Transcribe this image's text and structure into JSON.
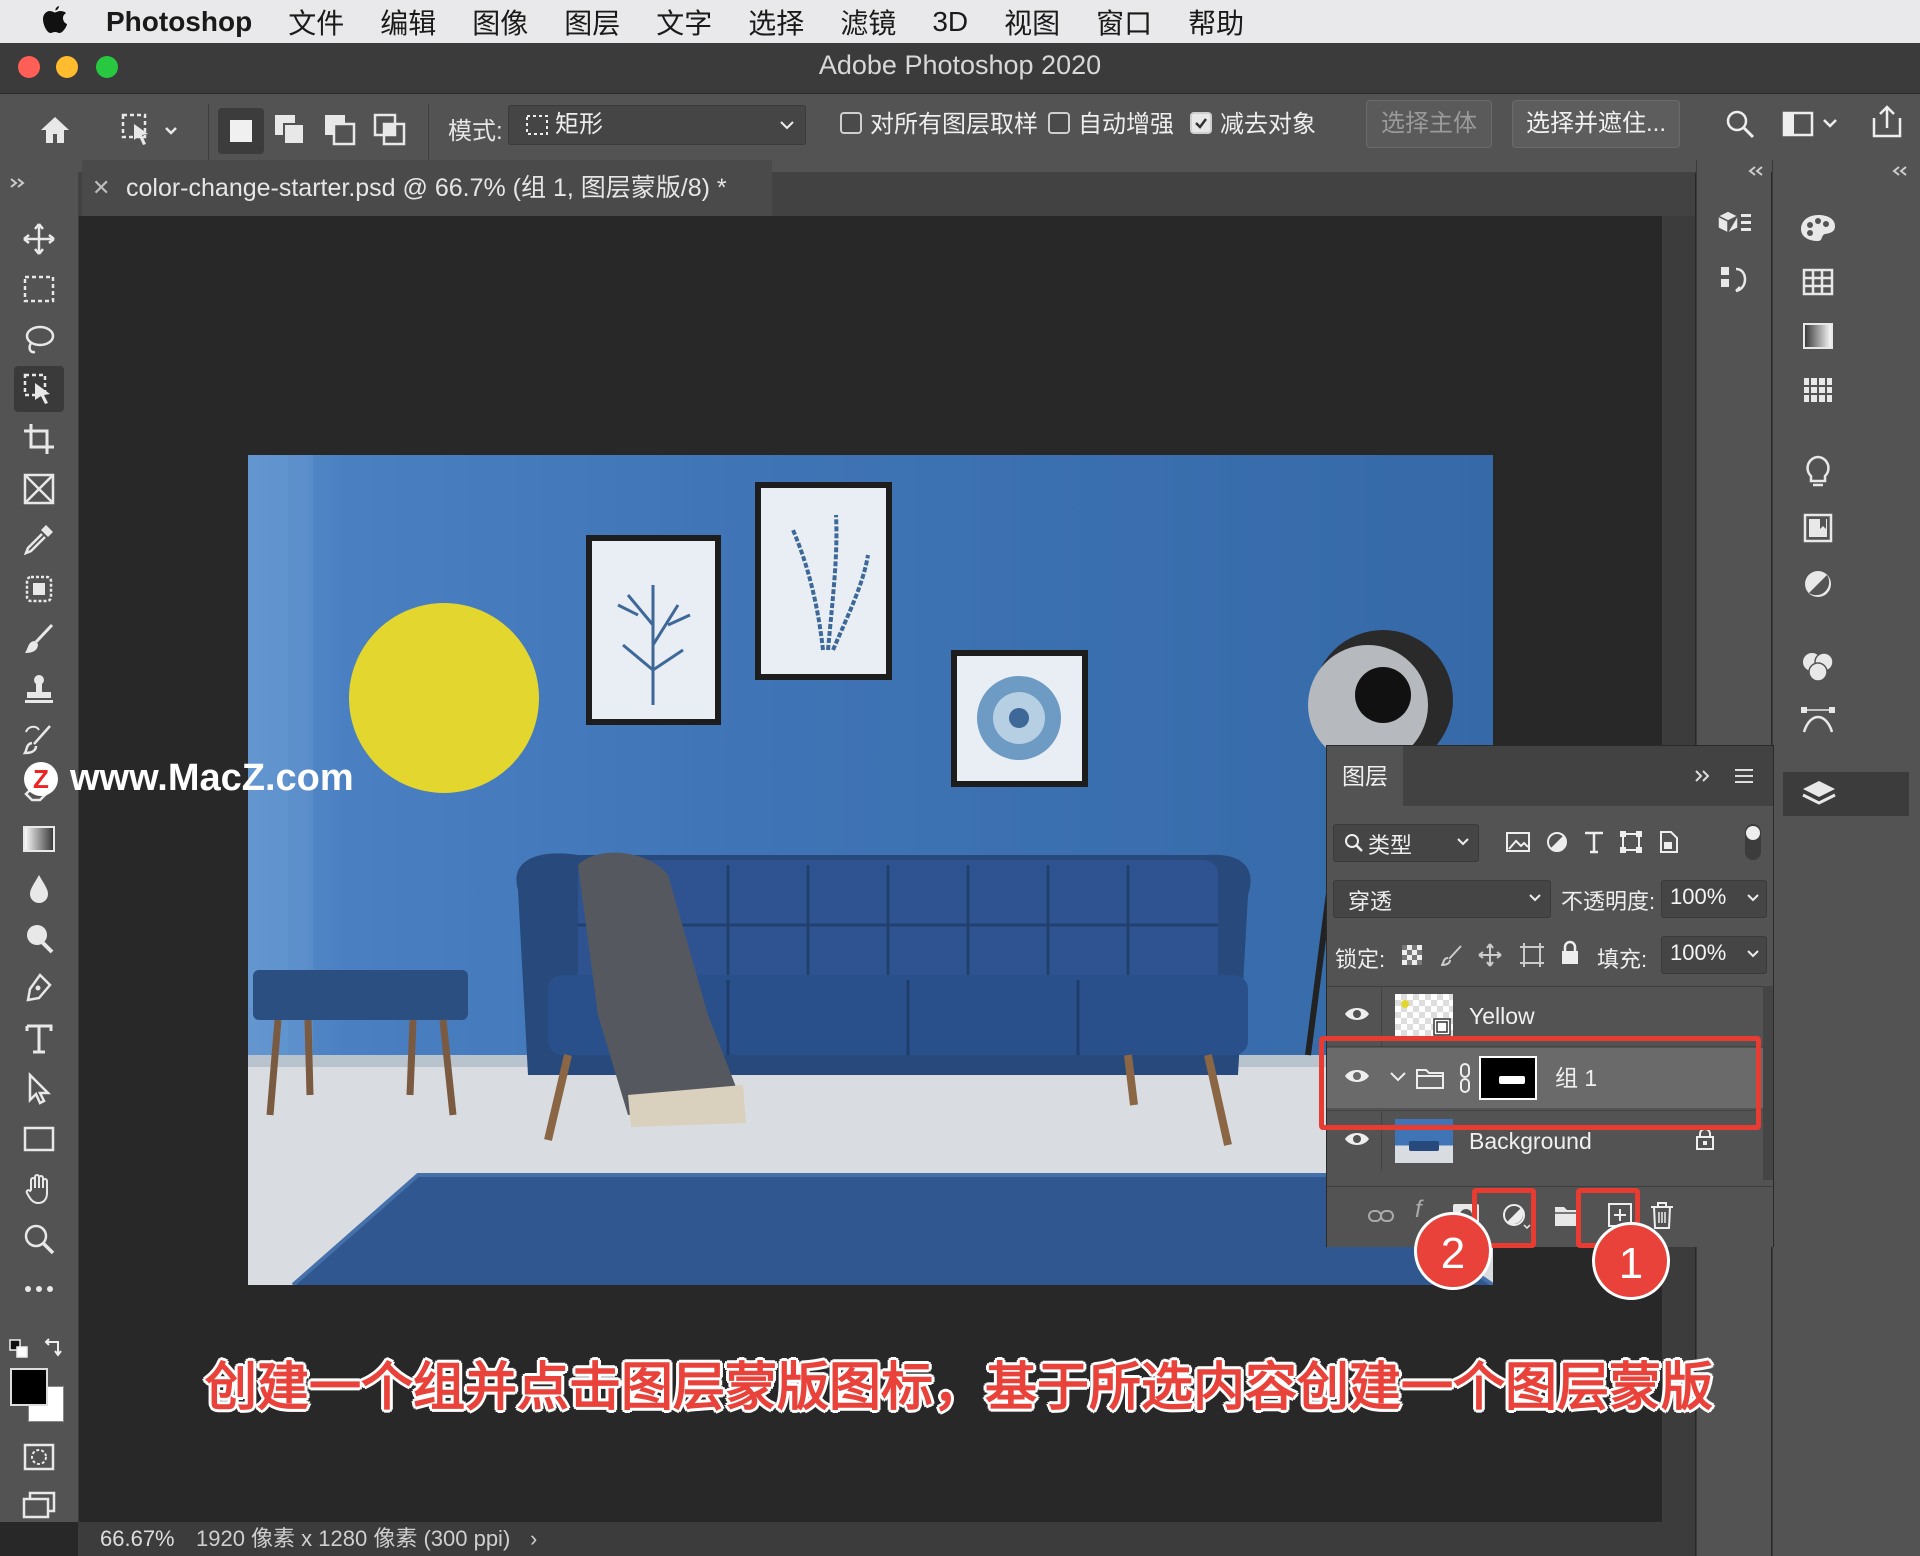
{
  "menubar": {
    "app": "Photoshop",
    "items": [
      "文件",
      "编辑",
      "图像",
      "图层",
      "文字",
      "选择",
      "滤镜",
      "3D",
      "视图",
      "窗口",
      "帮助"
    ]
  },
  "window": {
    "title": "Adobe Photoshop 2020"
  },
  "options": {
    "mode_label": "模式:",
    "mode_value": "矩形",
    "sample_all_label": "对所有图层取样",
    "auto_enhance_label": "自动增强",
    "subtract_label": "减去对象",
    "select_subject": "选择主体",
    "select_mask": "选择并遮住..."
  },
  "document": {
    "tab_title": "color-change-starter.psd @ 66.7% (组 1, 图层蒙版/8) *"
  },
  "status": {
    "zoom": "66.67%",
    "info": "1920 像素 x 1280 像素 (300 ppi)"
  },
  "layers": {
    "panel_title": "图层",
    "filter_label": "类型",
    "blend_mode": "穿透",
    "opacity_label": "不透明度:",
    "opacity_value": "100%",
    "lock_label": "锁定:",
    "fill_label": "填充:",
    "fill_value": "100%",
    "rows": [
      {
        "name": "Yellow"
      },
      {
        "name": "组 1"
      },
      {
        "name": "Background"
      }
    ]
  },
  "annotations": {
    "badge_1": "1",
    "badge_2": "2",
    "caption": "创建一个组并点击图层蒙版图标，基于所选内容创建一个图层蒙版",
    "watermark": "www.MacZ.com",
    "watermark_logo": "Z"
  },
  "colors": {
    "accent_red": "#e8423a",
    "yellow_circle": "#e3d62e",
    "wall_blue": "#3f74b6"
  }
}
